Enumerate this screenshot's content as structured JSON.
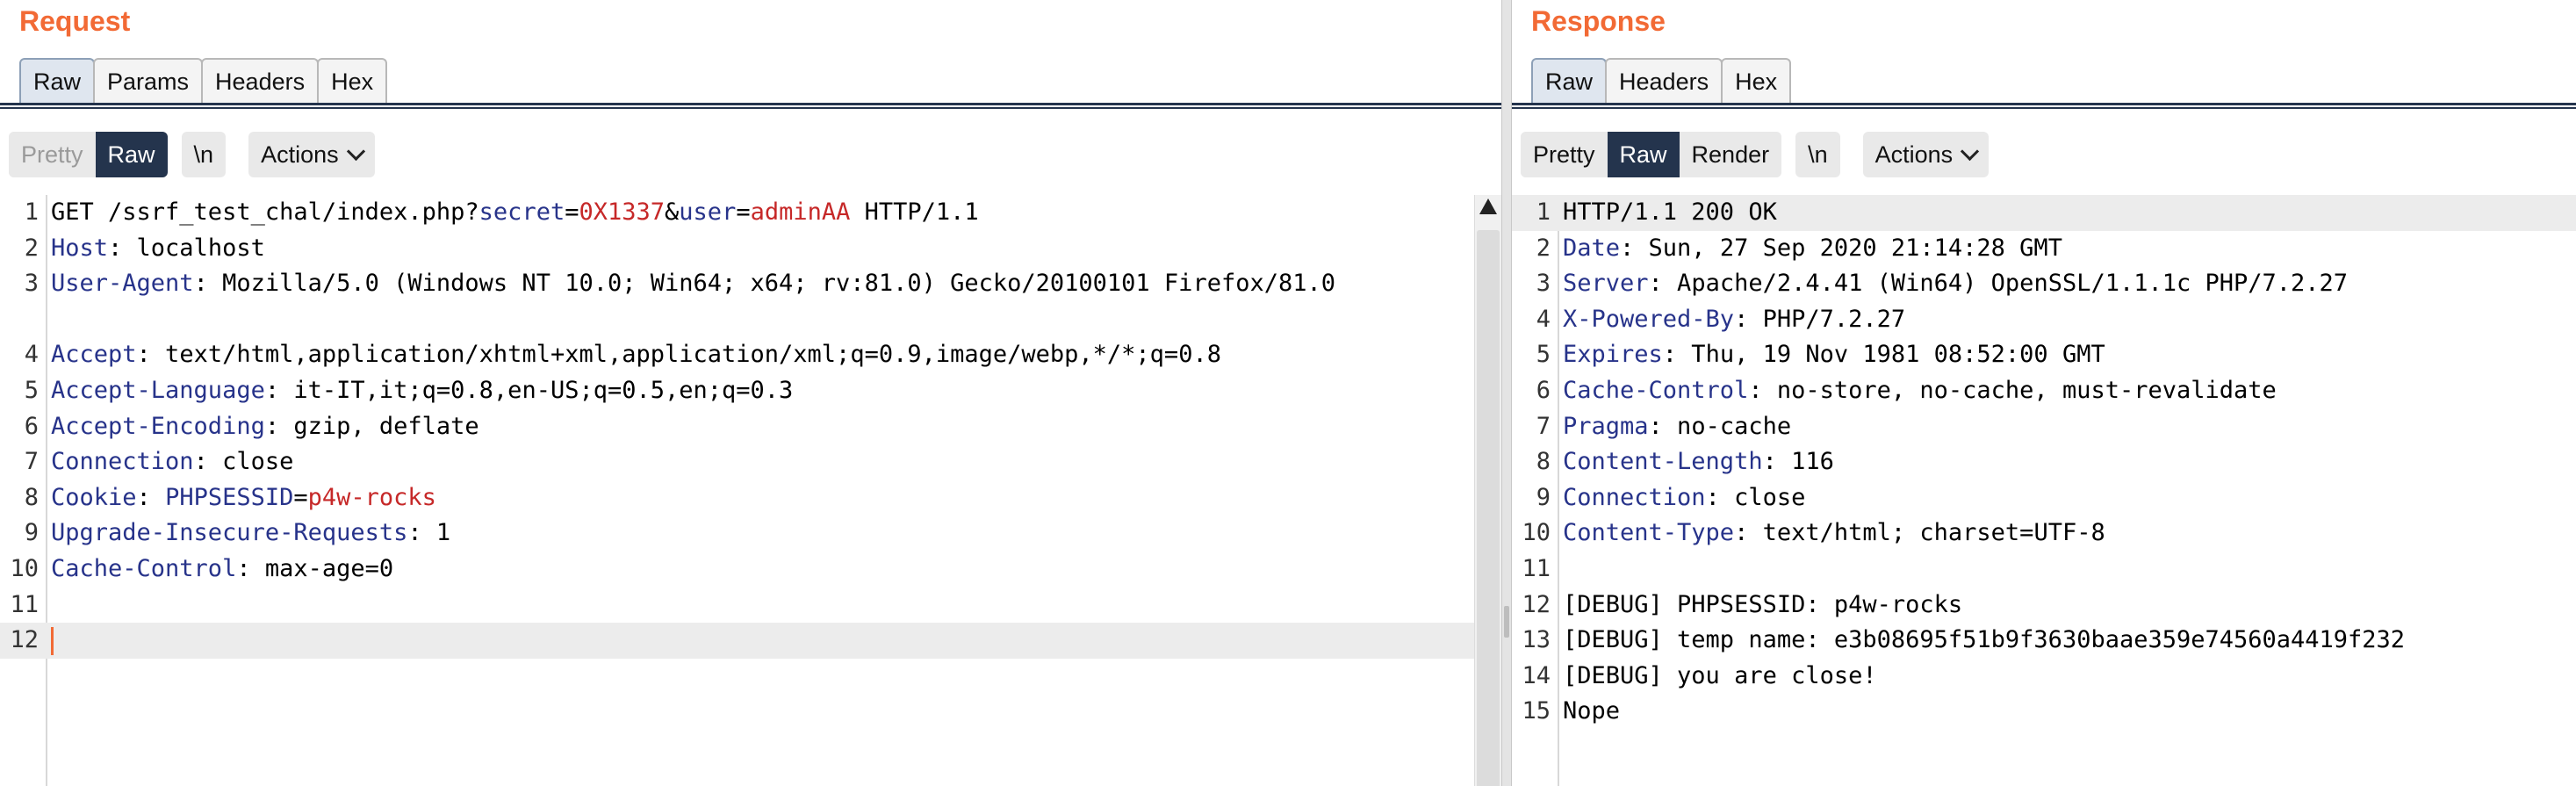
{
  "request": {
    "title": "Request",
    "tabs": [
      "Raw",
      "Params",
      "Headers",
      "Hex"
    ],
    "active_tab": "Raw",
    "toolbar": {
      "pretty": "Pretty",
      "raw": "Raw",
      "newline": "\\n",
      "actions": "Actions"
    },
    "lines": [
      {
        "n": "1",
        "segments": [
          {
            "t": "GET /ssrf_test_chal/index.php?",
            "c": ""
          },
          {
            "t": "secret",
            "c": "k"
          },
          {
            "t": "=",
            "c": ""
          },
          {
            "t": "0X1337",
            "c": "v"
          },
          {
            "t": "&",
            "c": ""
          },
          {
            "t": "user",
            "c": "k"
          },
          {
            "t": "=",
            "c": ""
          },
          {
            "t": "adminAA",
            "c": "v"
          },
          {
            "t": " HTTP/1.1",
            "c": ""
          }
        ]
      },
      {
        "n": "2",
        "segments": [
          {
            "t": "Host",
            "c": "k"
          },
          {
            "t": ": localhost",
            "c": ""
          }
        ]
      },
      {
        "n": "3",
        "wrap": true,
        "segments": [
          {
            "t": "User-Agent",
            "c": "k"
          },
          {
            "t": ": Mozilla/5.0 (Windows NT 10.0; Win64; x64; rv:81.0) Gecko/20100101 Firefox/81.0",
            "c": ""
          }
        ]
      },
      {
        "n": "4",
        "segments": [
          {
            "t": "Accept",
            "c": "k"
          },
          {
            "t": ": text/html,application/xhtml+xml,application/xml;q=0.9,image/webp,*/*;q=0.8",
            "c": ""
          }
        ]
      },
      {
        "n": "5",
        "segments": [
          {
            "t": "Accept-Language",
            "c": "k"
          },
          {
            "t": ": it-IT,it;q=0.8,en-US;q=0.5,en;q=0.3",
            "c": ""
          }
        ]
      },
      {
        "n": "6",
        "segments": [
          {
            "t": "Accept-Encoding",
            "c": "k"
          },
          {
            "t": ": gzip, deflate",
            "c": ""
          }
        ]
      },
      {
        "n": "7",
        "segments": [
          {
            "t": "Connection",
            "c": "k"
          },
          {
            "t": ": close",
            "c": ""
          }
        ]
      },
      {
        "n": "8",
        "segments": [
          {
            "t": "Cookie",
            "c": "k"
          },
          {
            "t": ": ",
            "c": ""
          },
          {
            "t": "PHPSESSID",
            "c": "k"
          },
          {
            "t": "=",
            "c": ""
          },
          {
            "t": "p4w-rocks",
            "c": "v"
          }
        ]
      },
      {
        "n": "9",
        "segments": [
          {
            "t": "Upgrade-Insecure-Requests",
            "c": "k"
          },
          {
            "t": ": 1",
            "c": ""
          }
        ]
      },
      {
        "n": "10",
        "segments": [
          {
            "t": "Cache-Control",
            "c": "k"
          },
          {
            "t": ": max-age=0",
            "c": ""
          }
        ]
      },
      {
        "n": "11",
        "segments": []
      },
      {
        "n": "12",
        "segments": [],
        "current": true
      }
    ]
  },
  "response": {
    "title": "Response",
    "tabs": [
      "Raw",
      "Headers",
      "Hex"
    ],
    "active_tab": "Raw",
    "toolbar": {
      "pretty": "Pretty",
      "raw": "Raw",
      "render": "Render",
      "newline": "\\n",
      "actions": "Actions"
    },
    "lines": [
      {
        "n": "1",
        "segments": [
          {
            "t": "HTTP/1.1 200 OK",
            "c": ""
          }
        ],
        "current": true
      },
      {
        "n": "2",
        "segments": [
          {
            "t": "Date",
            "c": "k"
          },
          {
            "t": ": Sun, 27 Sep 2020 21:14:28 GMT",
            "c": ""
          }
        ]
      },
      {
        "n": "3",
        "segments": [
          {
            "t": "Server",
            "c": "k"
          },
          {
            "t": ": Apache/2.4.41 (Win64) OpenSSL/1.1.1c PHP/7.2.27",
            "c": ""
          }
        ]
      },
      {
        "n": "4",
        "segments": [
          {
            "t": "X-Powered-By",
            "c": "k"
          },
          {
            "t": ": PHP/7.2.27",
            "c": ""
          }
        ]
      },
      {
        "n": "5",
        "segments": [
          {
            "t": "Expires",
            "c": "k"
          },
          {
            "t": ": Thu, 19 Nov 1981 08:52:00 GMT",
            "c": ""
          }
        ]
      },
      {
        "n": "6",
        "segments": [
          {
            "t": "Cache-Control",
            "c": "k"
          },
          {
            "t": ": no-store, no-cache, must-revalidate",
            "c": ""
          }
        ]
      },
      {
        "n": "7",
        "segments": [
          {
            "t": "Pragma",
            "c": "k"
          },
          {
            "t": ": no-cache",
            "c": ""
          }
        ]
      },
      {
        "n": "8",
        "segments": [
          {
            "t": "Content-Length",
            "c": "k"
          },
          {
            "t": ": 116",
            "c": ""
          }
        ]
      },
      {
        "n": "9",
        "segments": [
          {
            "t": "Connection",
            "c": "k"
          },
          {
            "t": ": close",
            "c": ""
          }
        ]
      },
      {
        "n": "10",
        "segments": [
          {
            "t": "Content-Type",
            "c": "k"
          },
          {
            "t": ": text/html; charset=UTF-8",
            "c": ""
          }
        ]
      },
      {
        "n": "11",
        "segments": []
      },
      {
        "n": "12",
        "segments": [
          {
            "t": "[DEBUG] PHPSESSID: p4w-rocks",
            "c": ""
          }
        ]
      },
      {
        "n": "13",
        "segments": [
          {
            "t": "[DEBUG] temp name: e3b08695f51b9f3630baae359e74560a4419f232",
            "c": ""
          }
        ]
      },
      {
        "n": "14",
        "segments": [
          {
            "t": "[DEBUG] you are close!",
            "c": ""
          }
        ]
      },
      {
        "n": "15",
        "segments": [
          {
            "t": "Nope",
            "c": ""
          }
        ]
      }
    ]
  },
  "colors": {
    "title": "#f26a35",
    "header_key": "#27338a",
    "param_value": "#c62828",
    "selected_button": "#24344d",
    "caret": "#f26a35"
  }
}
